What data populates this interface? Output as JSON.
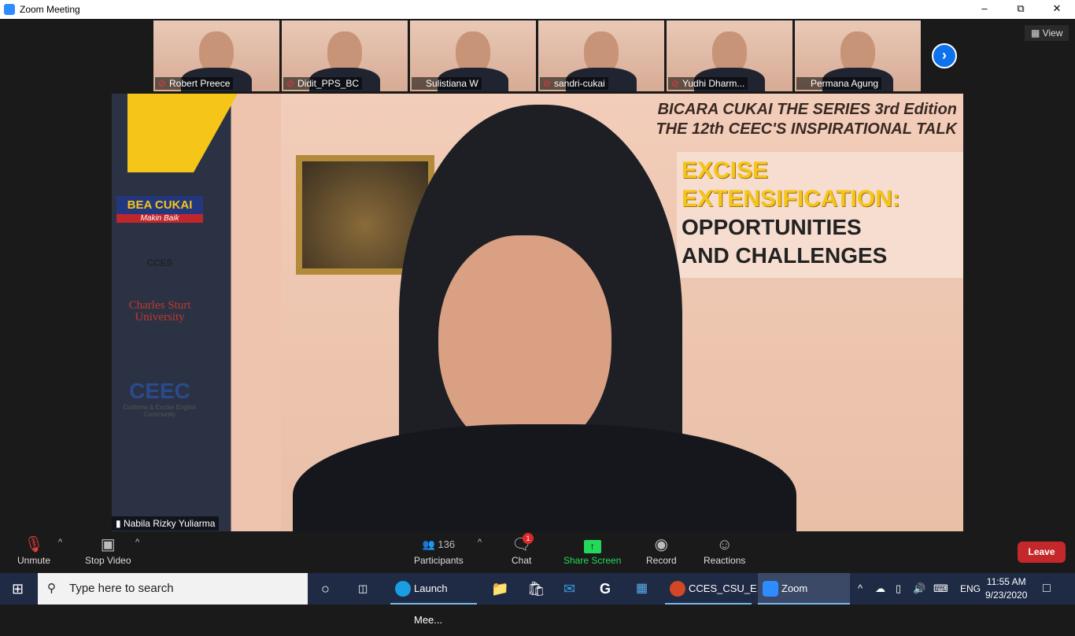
{
  "window": {
    "title": "Zoom Meeting",
    "controls": [
      "minimize",
      "restore",
      "close"
    ]
  },
  "view_label": "View",
  "participants_strip": [
    {
      "name": "Robert Preece",
      "muted": true
    },
    {
      "name": "Didit_PPS_BC",
      "muted": true
    },
    {
      "name": "Sulistiana W",
      "muted": false
    },
    {
      "name": "sandri-cukai",
      "muted": true
    },
    {
      "name": "Yudhi Dharm...",
      "muted": true
    },
    {
      "name": "Permana Agung",
      "muted": false
    }
  ],
  "main_video": {
    "speaker": "Nabila Rizky Yuliarma",
    "slide": {
      "line1": "BICARA CUKAI THE SERIES 3rd Edition",
      "line2": "THE 12th CEEC'S INSPIRATIONAL TALK",
      "topic1": "EXCISE",
      "topic2": "EXTENSIFICATION:",
      "topic3": "OPPORTUNITIES",
      "topic4": "AND CHALLENGES"
    },
    "logos": {
      "bea_cukai": "BEA CUKAI",
      "makin_baik": "Makin Baik",
      "cces": "CCES",
      "csu": "Charles Sturt University",
      "ceec": "CEEC",
      "ceec_sub": "Customs & Excise English Community"
    }
  },
  "toolbar": {
    "unmute": "Unmute",
    "stop_video": "Stop Video",
    "participants": "Participants",
    "participant_count": "136",
    "chat": "Chat",
    "chat_badge": "1",
    "share_screen": "Share Screen",
    "record": "Record",
    "reactions": "Reactions",
    "leave": "Leave",
    "share_color": "#23d959",
    "leave_color": "#c4282b"
  },
  "taskbar": {
    "search_placeholder": "Type here to search",
    "apps": [
      {
        "label": "Launch Mee..."
      },
      {
        "label": "CCES_CSU_E..."
      },
      {
        "label": "Zoom"
      }
    ],
    "lang": "ENG",
    "time": "11:55 AM",
    "date": "9/23/2020"
  }
}
